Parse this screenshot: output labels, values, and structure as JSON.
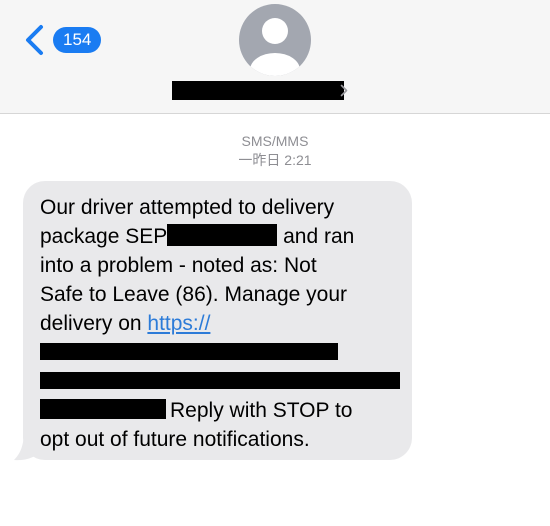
{
  "header": {
    "back_count": "154",
    "avatar": "person-icon",
    "contact_name_redacted": true
  },
  "conversation": {
    "service_label": "SMS/MMS",
    "timestamp": "一昨日 2:21"
  },
  "message": {
    "line1": "Our driver attempted to delivery",
    "line2_a": "package SEP",
    "line2_b": " and ran",
    "line3": "into a problem - noted as: Not",
    "line4": "Safe to Leave (86). Manage your",
    "line5_a": "delivery on ",
    "line5_link": "https://",
    "line8_b": "Reply with STOP to",
    "line9": "opt out of future notifications."
  },
  "colors": {
    "accent": "#1a7cf2",
    "bubble": "#e9e9eb",
    "link": "#2c7bd8",
    "meta": "#8e8e93"
  }
}
